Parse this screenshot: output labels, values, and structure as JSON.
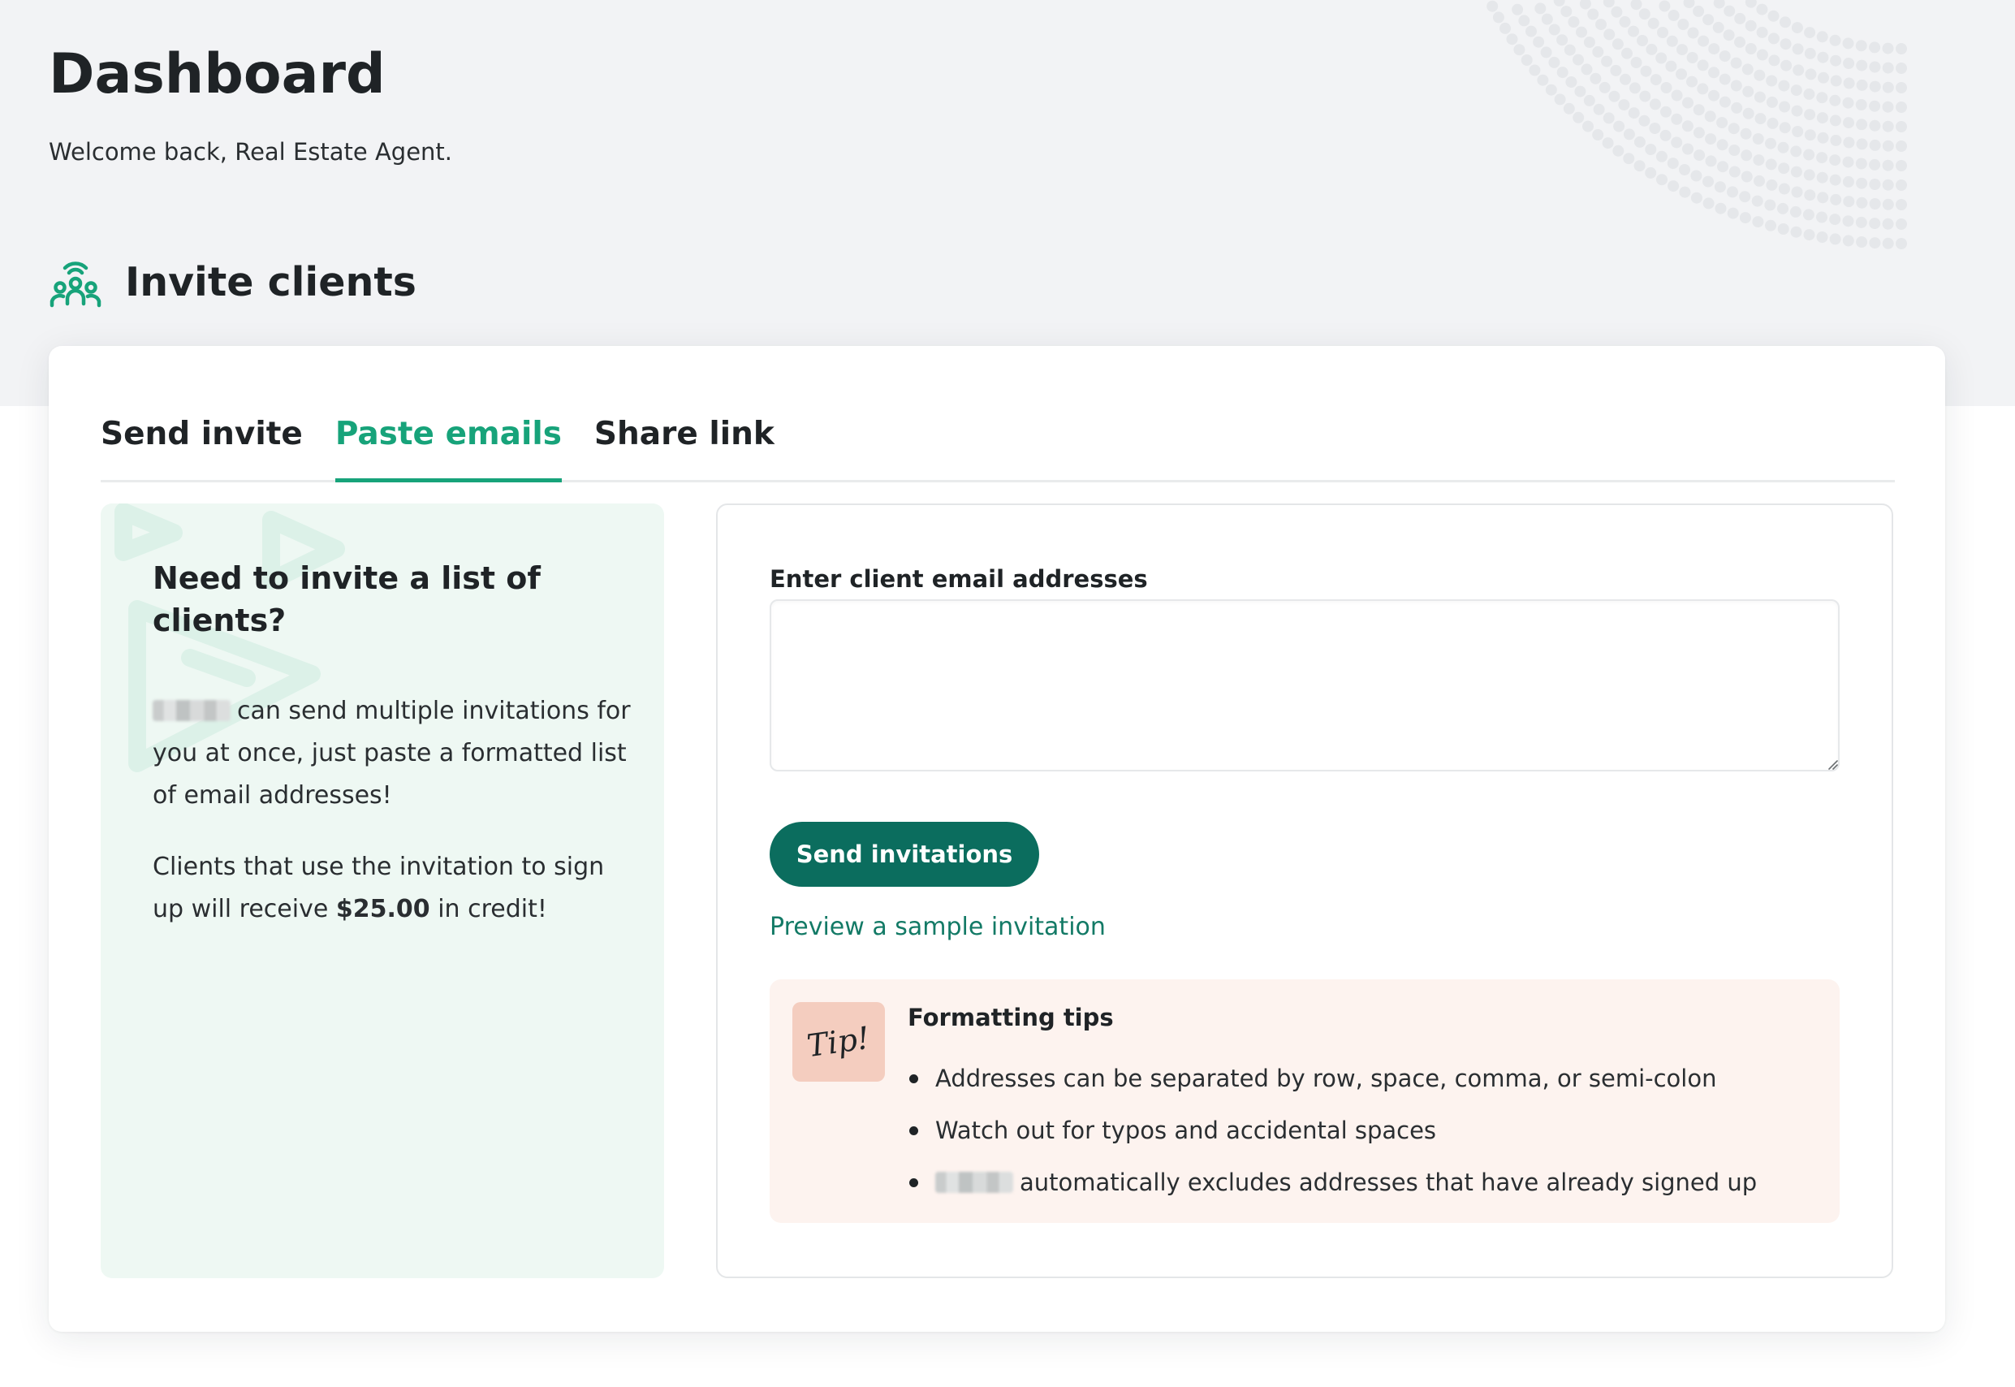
{
  "page": {
    "title": "Dashboard",
    "welcome": "Welcome back, Real Estate Agent."
  },
  "section": {
    "icon": "clients-broadcast-icon",
    "title": "Invite clients"
  },
  "tabs": [
    {
      "label": "Send invite",
      "active": false
    },
    {
      "label": "Paste emails",
      "active": true
    },
    {
      "label": "Share link",
      "active": false
    }
  ],
  "info": {
    "heading": "Need to invite a list of clients?",
    "p1_text": "can send multiple invitations for you at once, just paste a formatted list of email addresses!",
    "p2_before": "Clients that use the invitation to sign up will receive",
    "p2_amount": "$25.00",
    "p2_after": "in credit!"
  },
  "form": {
    "label": "Enter client email addresses",
    "value": "",
    "button": "Send invitations",
    "preview_link": "Preview a sample invitation"
  },
  "tips": {
    "badge": "Tip!",
    "title": "Formatting tips",
    "items": [
      "Addresses can be separated by row, space, comma, or semi-colon",
      "Watch out for typos and accidental spaces",
      "automatically excludes addresses that have already signed up"
    ]
  },
  "colors": {
    "accent": "#17a37a",
    "button": "#0b6d5e",
    "link": "#137a66",
    "info_bg": "#eef8f3",
    "tips_bg": "#fdf3ef",
    "tip_badge": "#f4cdbf"
  }
}
